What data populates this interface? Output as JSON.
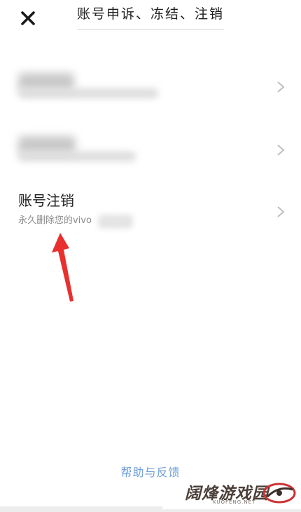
{
  "header": {
    "title": "账号申诉、冻结、注销",
    "close_icon": "close-icon"
  },
  "rows": [
    {
      "blurred": true
    },
    {
      "blurred": true
    },
    {
      "title": "账号注销",
      "subtitle": "永久删除您的vivo",
      "chevron_icon": "chevron-right-icon"
    }
  ],
  "annotation": {
    "arrow_icon": "red-arrow-icon",
    "color": "#e8302f"
  },
  "footer": {
    "link": "帮助与反馈",
    "link_color": "#6f9fd8"
  },
  "watermark": {
    "text": "阔烽游戏园",
    "sub": "KUOFENG.NET"
  }
}
